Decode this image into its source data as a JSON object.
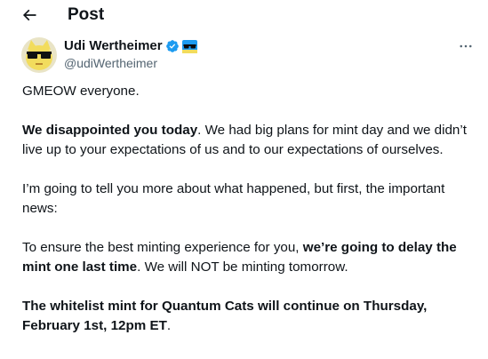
{
  "header": {
    "back_icon": "arrow-left-icon",
    "title": "Post"
  },
  "author": {
    "display_name": "Udi Wertheimer",
    "handle": "@udiWertheimer",
    "verified_icon": "verified-badge-icon",
    "badge_icon": "sunglasses-emoji-icon",
    "avatar_icon": "cat-sunglasses-avatar"
  },
  "more_icon": "more-options-icon",
  "tweet": {
    "p1": "GMEOW everyone.",
    "p2_bold": "We disappointed you today",
    "p2_rest": ". We had big plans for mint day and we didn’t live up to your expectations of us and to our expectations of ourselves.",
    "p3": "I’m going to tell you more about what happened, but first, the important news:",
    "p4_pre": "To ensure the best minting experience for you, ",
    "p4_bold": "we’re going to delay the mint one last time",
    "p4_post": ". We will NOT be minting tomorrow.",
    "p5_bold": "The whitelist mint for Quantum Cats will continue on Thursday, February 1st, 12pm ET",
    "p5_post": "."
  },
  "colors": {
    "text": "#0f1419",
    "secondary": "#536471",
    "verified": "#1d9bf0",
    "background": "#ffffff"
  }
}
